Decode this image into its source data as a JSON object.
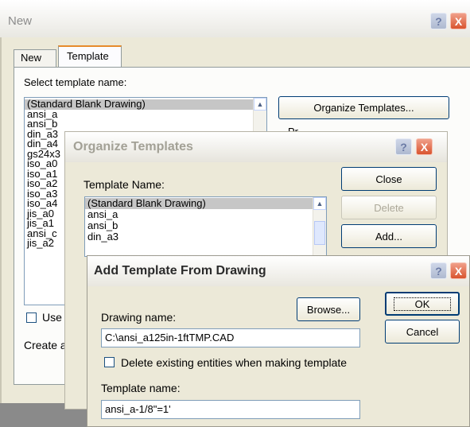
{
  "new_dialog": {
    "title": "New",
    "tabs": [
      "New",
      "Template"
    ],
    "select_label": "Select template name:",
    "templates": [
      "(Standard Blank Drawing)",
      "ansi_a",
      "ansi_b",
      "din_a3",
      "din_a4",
      "gs24x3",
      "iso_a0",
      "iso_a1",
      "iso_a2",
      "iso_a3",
      "iso_a4",
      "jis_a0",
      "jis_a1",
      "ansi_c",
      "jis_a2"
    ],
    "organize_button": "Organize Templates...",
    "preview_label_partial": "Pr",
    "use_label_partial": "Use",
    "create_label_partial": "Create a"
  },
  "organize_dialog": {
    "title": "Organize Templates",
    "template_name_label": "Template Name:",
    "templates": [
      "(Standard Blank Drawing)",
      "ansi_a",
      "ansi_b",
      "din_a3"
    ],
    "close_button": "Close",
    "delete_button": "Delete",
    "add_button": "Add..."
  },
  "add_dialog": {
    "title": "Add Template From Drawing",
    "drawing_name_label": "Drawing name:",
    "browse_button": "Browse...",
    "drawing_name_value": "C:\\ansi_a125in-1ftTMP.CAD",
    "delete_entities_label": "Delete existing entities when making template",
    "template_name_label": "Template name:",
    "template_name_value": "ansi_a-1/8\"=1'",
    "ok_button": "OK",
    "cancel_button": "Cancel"
  },
  "title_buttons": {
    "help": "?",
    "close": "X"
  },
  "colors": {
    "dialog_bg": "#ece9d8",
    "inactive_title": "#d6d3c6",
    "active_title": "#f4f3ee"
  }
}
